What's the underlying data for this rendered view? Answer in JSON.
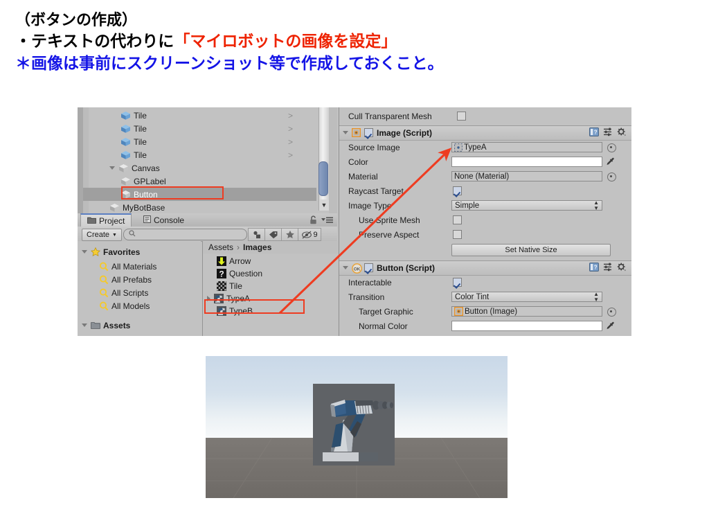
{
  "slide": {
    "line1": "（ボタンの作成）",
    "line2_black": "・テキストの代わりに",
    "line2_red": "「マイロボットの画像を設定」",
    "line3": "＊画像は事前にスクリーンショット等で作成しておくこと。",
    "colors": {
      "red": "#ee2200",
      "blue": "#1414e6",
      "black": "#000000",
      "highlight_box": "#ee3c21"
    }
  },
  "hierarchy": {
    "items": [
      {
        "label": "Tile",
        "indent": 2,
        "icon": "cube-blue-icon",
        "expand": "none",
        "chevron": ">",
        "selected": false
      },
      {
        "label": "Tile",
        "indent": 2,
        "icon": "cube-blue-icon",
        "expand": "none",
        "chevron": ">",
        "selected": false
      },
      {
        "label": "Tile",
        "indent": 2,
        "icon": "cube-blue-icon",
        "expand": "none",
        "chevron": ">",
        "selected": false
      },
      {
        "label": "Tile",
        "indent": 2,
        "icon": "cube-blue-icon",
        "expand": "none",
        "chevron": ">",
        "selected": false
      },
      {
        "label": "Canvas",
        "indent": 1,
        "icon": "cube-white-icon",
        "expand": "expanded",
        "chevron": "",
        "selected": false
      },
      {
        "label": "GPLabel",
        "indent": 2,
        "icon": "cube-white-icon",
        "expand": "none",
        "chevron": "",
        "selected": false
      },
      {
        "label": "Button",
        "indent": 2,
        "icon": "cube-white-icon",
        "expand": "none",
        "chevron": "",
        "selected": true
      },
      {
        "label": "MyBotBase",
        "indent": 1,
        "icon": "cube-white-icon",
        "expand": "none",
        "chevron": "",
        "selected": false
      }
    ]
  },
  "project": {
    "tabs": [
      {
        "label": "Project",
        "icon": "folder-icon",
        "active": true
      },
      {
        "label": "Console",
        "icon": "console-icon",
        "active": false
      }
    ],
    "lock_icon": "lock-icon",
    "menu_icon": "panel-menu-icon",
    "create_button": "Create",
    "search_placeholder": "",
    "toolbar_buttons": [
      {
        "name": "filter-by-type-icon",
        "label": ""
      },
      {
        "name": "filter-by-label-icon",
        "label": ""
      },
      {
        "name": "favorite-star-icon",
        "label": ""
      },
      {
        "name": "hidden-count-icon",
        "label": "9"
      }
    ],
    "tree": [
      {
        "label": "Favorites",
        "icon": "star-icon",
        "indent": 0,
        "expand": "expanded"
      },
      {
        "label": "All Materials",
        "icon": "search-icon",
        "indent": 1,
        "expand": "none"
      },
      {
        "label": "All Prefabs",
        "icon": "search-icon",
        "indent": 1,
        "expand": "none"
      },
      {
        "label": "All Scripts",
        "icon": "search-icon",
        "indent": 1,
        "expand": "none"
      },
      {
        "label": "All Models",
        "icon": "search-icon",
        "indent": 1,
        "expand": "none"
      },
      {
        "label": "Assets",
        "icon": "folder-icon",
        "indent": 0,
        "expand": "expanded"
      }
    ],
    "breadcrumb": {
      "root": "Assets",
      "separator": "›",
      "current": "Images"
    },
    "assets": [
      {
        "label": "Arrow",
        "icon": "arrow-sprite-icon",
        "expand": "none",
        "highlighted": false
      },
      {
        "label": "Question",
        "icon": "question-sprite-icon",
        "expand": "none",
        "highlighted": false
      },
      {
        "label": "Tile",
        "icon": "tile-sprite-icon",
        "expand": "none",
        "highlighted": false
      },
      {
        "label": "TypeA",
        "icon": "robot-sprite-icon",
        "expand": "collapsed",
        "highlighted": true
      },
      {
        "label": "TypeB",
        "icon": "robot-sprite-icon",
        "expand": "none",
        "highlighted": false
      }
    ]
  },
  "inspector": {
    "top_row": {
      "label": "Cull Transparent Mesh",
      "checked": false
    },
    "components": [
      {
        "title": "Image (Script)",
        "icon": "image-script-icon",
        "enabled": true,
        "expanded": true,
        "header_icons": [
          "help-icon",
          "preset-icon",
          "gear-icon"
        ],
        "rows": [
          {
            "label": "Source Image",
            "type": "object-field",
            "value": "TypeA",
            "value_icon": "sprite-icon",
            "picker": true
          },
          {
            "label": "Color",
            "type": "color-field",
            "value": "",
            "eyedropper": true
          },
          {
            "label": "Material",
            "type": "object-field",
            "value": "None (Material)",
            "picker": true
          },
          {
            "label": "Raycast Target",
            "type": "checkbox",
            "checked": true
          },
          {
            "label": "Image Type",
            "type": "popup",
            "value": "Simple"
          },
          {
            "label": "Use Sprite Mesh",
            "type": "checkbox",
            "checked": false,
            "sub": true
          },
          {
            "label": "Preserve Aspect",
            "type": "checkbox",
            "checked": false,
            "sub": true
          },
          {
            "label": "",
            "type": "button",
            "value": "Set Native Size"
          }
        ]
      },
      {
        "title": "Button (Script)",
        "icon": "button-script-icon",
        "icon_text": "OK",
        "enabled": true,
        "expanded": true,
        "header_icons": [
          "help-icon",
          "preset-icon",
          "gear-icon"
        ],
        "rows": [
          {
            "label": "Interactable",
            "type": "checkbox",
            "checked": true
          },
          {
            "label": "Transition",
            "type": "popup",
            "value": "Color Tint"
          },
          {
            "label": "Target Graphic",
            "type": "object-field",
            "value": "Button (Image)",
            "value_icon": "image-script-icon",
            "picker": true,
            "sub": true
          },
          {
            "label": "Normal Color",
            "type": "color-field",
            "value": "",
            "eyedropper": true,
            "sub": true
          }
        ]
      }
    ]
  },
  "annotation": {
    "arrow_color": "#ee3c21",
    "from": "TypeA asset in Project window",
    "to": "Source Image field of Image (Script)"
  },
  "game_view": {
    "description": "Unity game view showing a UI button whose sprite is a screenshot of the robot arm",
    "button_sprite_label": "TypeA",
    "sky_color": "#d5e1ec",
    "ground_color": "#77736f"
  }
}
